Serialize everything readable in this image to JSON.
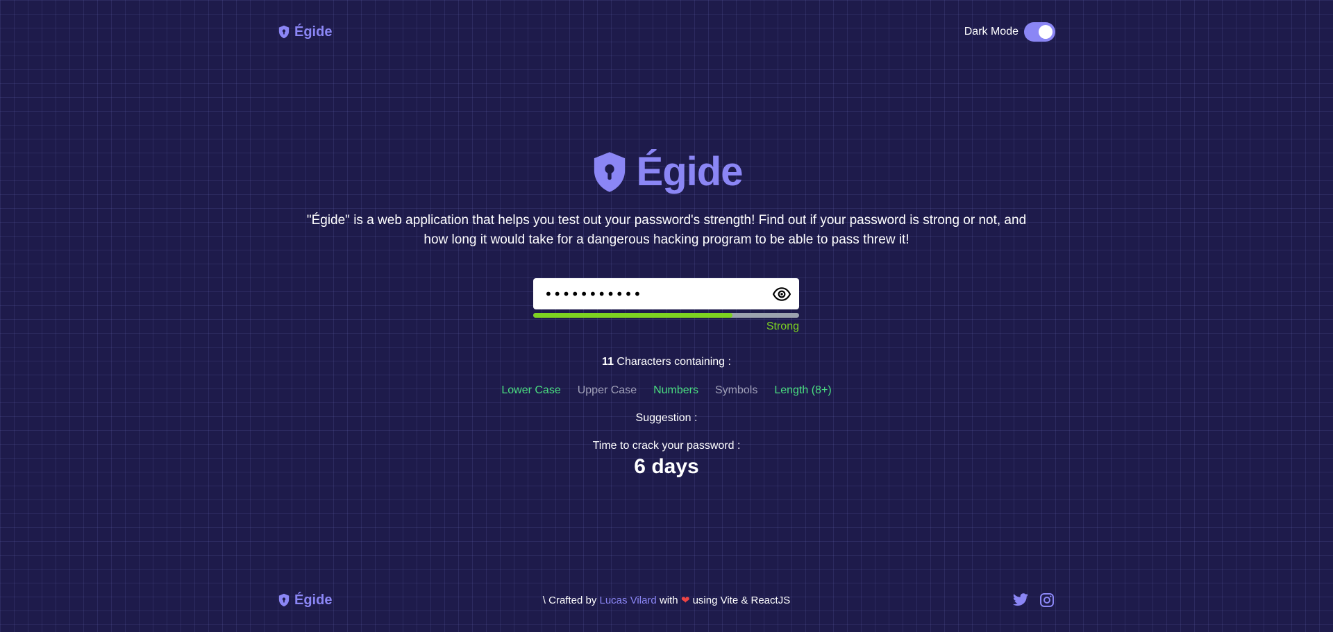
{
  "header": {
    "brand": "Égide",
    "dark_mode_label": "Dark Mode",
    "dark_mode_on": true
  },
  "hero": {
    "title": "Égide",
    "description_line1": "\"Égide\" is a web application that helps you test out your password's strength! Find out if your password is strong or not, and",
    "description_line2": "how long it would take for a dangerous hacking program to be able to pass threw it!"
  },
  "password": {
    "masked_value": "•••••••••••",
    "type": "password",
    "visibility_icon": "eye-icon",
    "strength_fraction": 0.75,
    "strength_label": "Strong"
  },
  "analysis": {
    "char_count": "11",
    "containing_label": "Characters containing :",
    "criteria": [
      {
        "label": "Lower Case",
        "met": true
      },
      {
        "label": "Upper Case",
        "met": false
      },
      {
        "label": "Numbers",
        "met": true
      },
      {
        "label": "Symbols",
        "met": false
      },
      {
        "label": "Length (8+)",
        "met": true
      }
    ],
    "suggestion_label": "Suggestion :",
    "crack_time_label": "Time to crack your password :",
    "crack_time_value": "6 days"
  },
  "footer": {
    "brand": "Égide",
    "credit_prefix": "\\ Crafted by",
    "author": "Lucas Vilard",
    "credit_with": "with",
    "credit_suffix": "using Vite & ReactJS",
    "socials": [
      "twitter-icon",
      "instagram-icon"
    ]
  },
  "colors": {
    "background": "#1e1b4b",
    "accent": "#8b86f5",
    "strength_green": "#7ed321",
    "criteria_met": "#4ade80",
    "criteria_unmet": "#a0a0b8"
  }
}
